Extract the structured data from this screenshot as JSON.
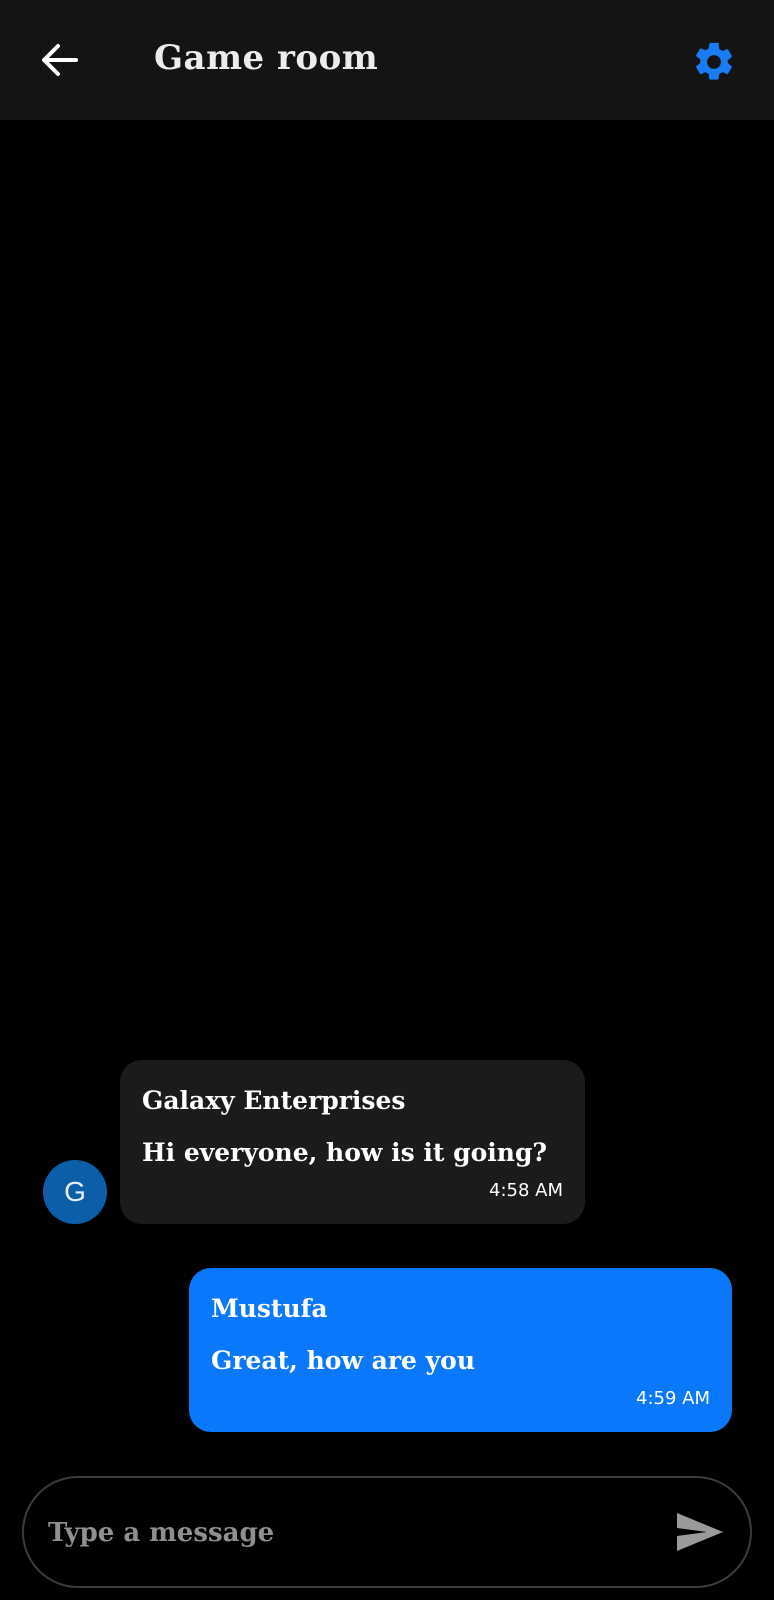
{
  "header": {
    "title": "Game room",
    "back_icon": "arrow-left-icon",
    "settings_icon": "gear-icon"
  },
  "messages": [
    {
      "avatar_initial": "G",
      "sender": "Galaxy Enterprises",
      "text": "Hi everyone, how is it going?",
      "time": "4:58 AM",
      "direction": "incoming"
    },
    {
      "sender": "Mustufa",
      "text": "Great, how are you",
      "time": "4:59 AM",
      "direction": "outgoing"
    }
  ],
  "composer": {
    "placeholder": "Type a message",
    "send_icon": "send-icon"
  },
  "colors": {
    "accent": "#0a78fb",
    "header_bg": "#141414",
    "incoming_bubble": "#1b1b1b",
    "avatar_bg": "#0d5ea8"
  }
}
